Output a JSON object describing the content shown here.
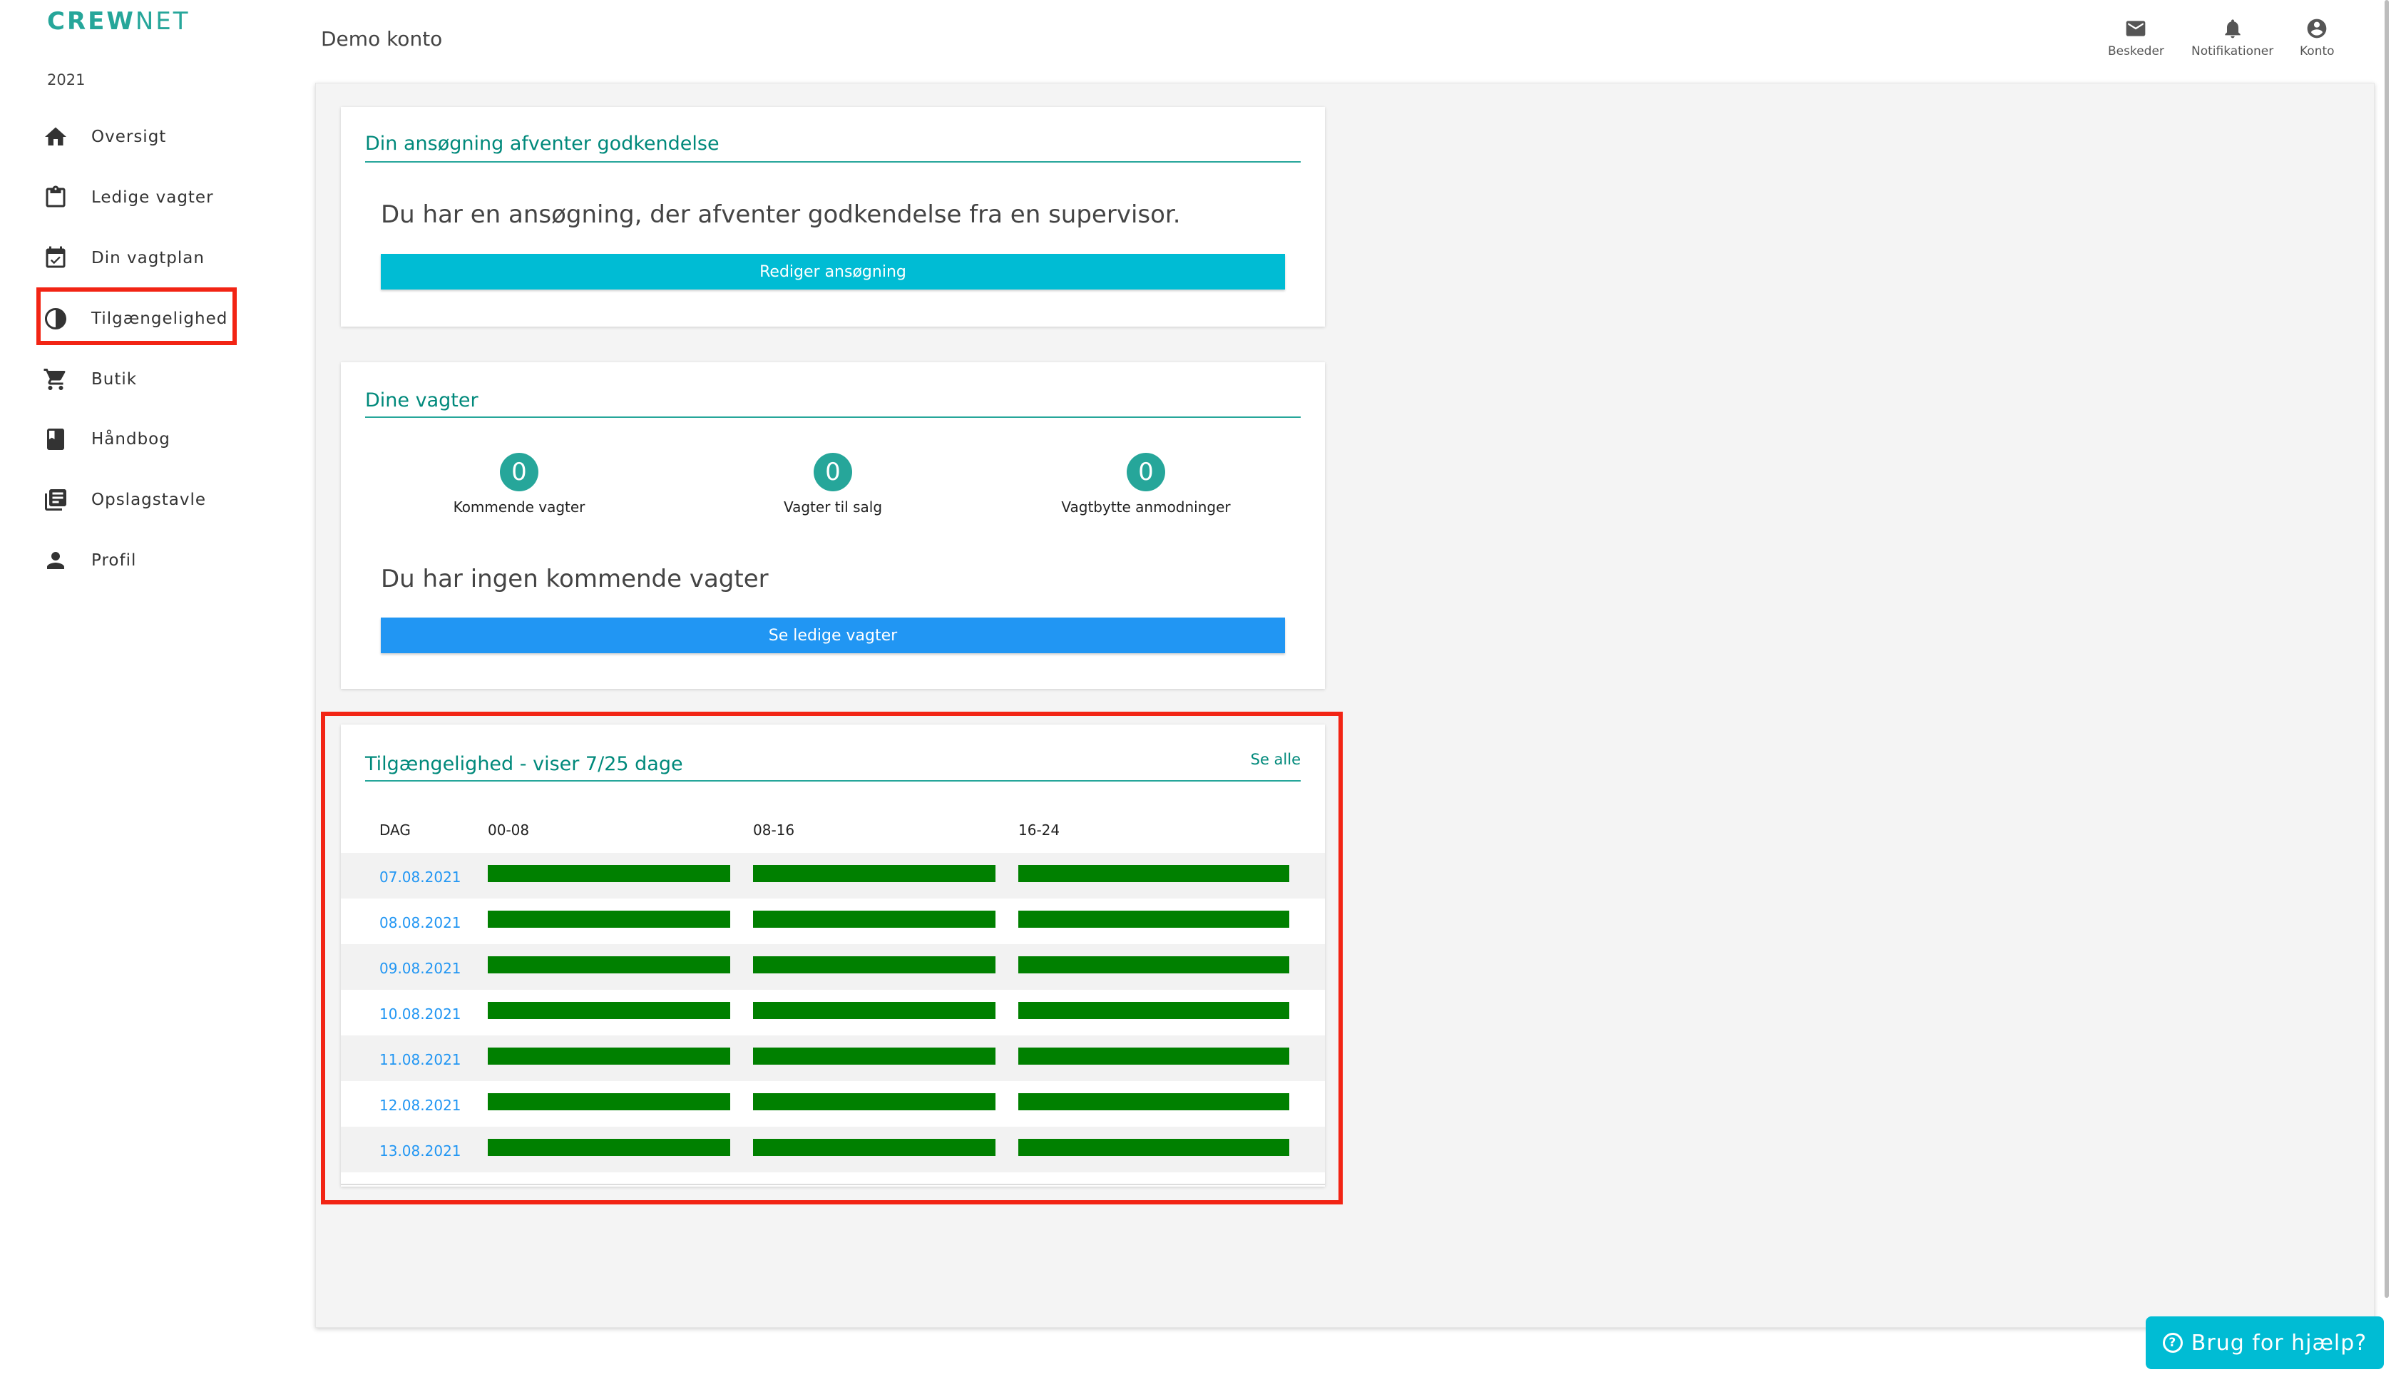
{
  "app": {
    "logo_bold": "CREW",
    "logo_light": "NET",
    "year": "2021"
  },
  "sidebar": {
    "items": [
      {
        "label": "Oversigt",
        "icon": "home-icon"
      },
      {
        "label": "Ledige vagter",
        "icon": "clipboard-icon"
      },
      {
        "label": "Din vagtplan",
        "icon": "calendar-check-icon"
      },
      {
        "label": "Tilgængelighed",
        "icon": "contrast-icon"
      },
      {
        "label": "Butik",
        "icon": "shopping-cart-icon"
      },
      {
        "label": "Håndbog",
        "icon": "book-icon"
      },
      {
        "label": "Opslagstavle",
        "icon": "newspaper-icon"
      },
      {
        "label": "Profil",
        "icon": "person-icon"
      }
    ]
  },
  "header": {
    "account": "Demo konto",
    "actions": [
      {
        "label": "Beskeder",
        "icon": "mail-icon"
      },
      {
        "label": "Notifikationer",
        "icon": "bell-icon"
      },
      {
        "label": "Konto",
        "icon": "account-circle-icon"
      }
    ]
  },
  "application_card": {
    "title": "Din ansøgning afventer godkendelse",
    "message": "Du har en ansøgning, der afventer godkendelse fra en supervisor.",
    "button": "Rediger ansøgning",
    "button_color": "#00bcd4"
  },
  "shifts_card": {
    "title": "Dine vagter",
    "stats": [
      {
        "value": "0",
        "label": "Kommende vagter"
      },
      {
        "value": "0",
        "label": "Vagter til salg"
      },
      {
        "value": "0",
        "label": "Vagtbytte anmodninger"
      }
    ],
    "message": "Du har ingen kommende vagter",
    "button": "Se ledige vagter",
    "button_color": "#2196f3"
  },
  "availability_card": {
    "title": "Tilgængelighed - viser 7/25 dage",
    "see_all": "Se alle",
    "columns": [
      "DAG",
      "00-08",
      "08-16",
      "16-24"
    ],
    "rows": [
      {
        "date": "07.08.2021"
      },
      {
        "date": "08.08.2021"
      },
      {
        "date": "09.08.2021"
      },
      {
        "date": "10.08.2021"
      },
      {
        "date": "11.08.2021"
      },
      {
        "date": "12.08.2021"
      },
      {
        "date": "13.08.2021"
      }
    ],
    "available_color": "#008000"
  },
  "help_button": "Brug for hjælp?",
  "accent_color": "#26a69a",
  "highlight_color": "#f22414"
}
